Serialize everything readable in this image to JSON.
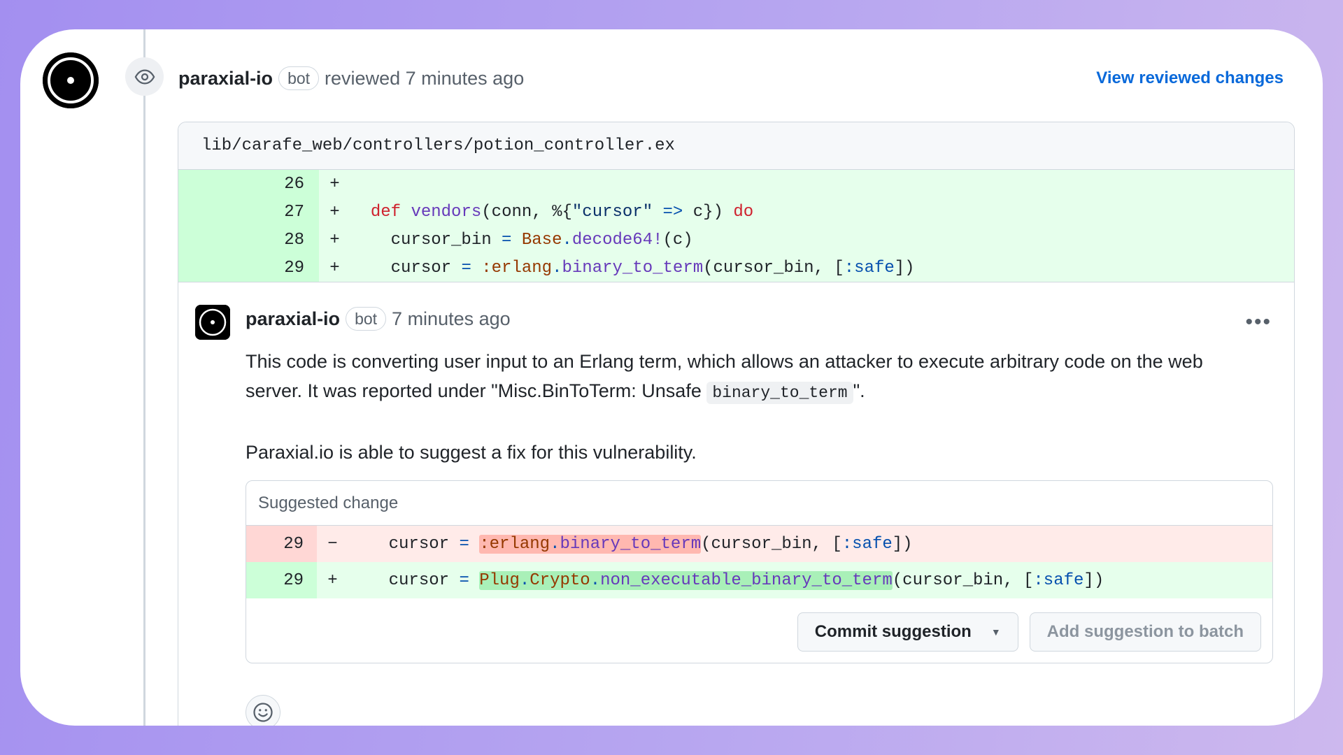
{
  "review": {
    "author": "paraxial-io",
    "badge": "bot",
    "action": "reviewed 7 minutes ago",
    "view_changes_label": "View reviewed changes"
  },
  "file": {
    "path": "lib/carafe_web/controllers/potion_controller.ex",
    "lines": [
      {
        "num": "26",
        "sign": "+"
      },
      {
        "num": "27",
        "sign": "+"
      },
      {
        "num": "28",
        "sign": "+"
      },
      {
        "num": "29",
        "sign": "+"
      }
    ]
  },
  "comment": {
    "author": "paraxial-io",
    "badge": "bot",
    "time": "7 minutes ago",
    "menu_icon": "kebab-horizontal-icon",
    "para1_a": "This code is converting user input to an Erlang term, which allows an attacker to execute arbitrary code on the web server. It was reported under \"Misc.BinToTerm: Unsafe ",
    "para1_code": "binary_to_term",
    "para1_b": "\".",
    "para2": "Paraxial.io is able to suggest a fix for this vulnerability."
  },
  "suggestion": {
    "title": "Suggested change",
    "del_num": "29",
    "del_sign": "−",
    "add_num": "29",
    "add_sign": "+",
    "commit_label": "Commit suggestion",
    "batch_label": "Add suggestion to batch"
  },
  "colors": {
    "link": "#0969da",
    "add_bg": "#e6ffec",
    "del_bg": "#ffebe9"
  }
}
